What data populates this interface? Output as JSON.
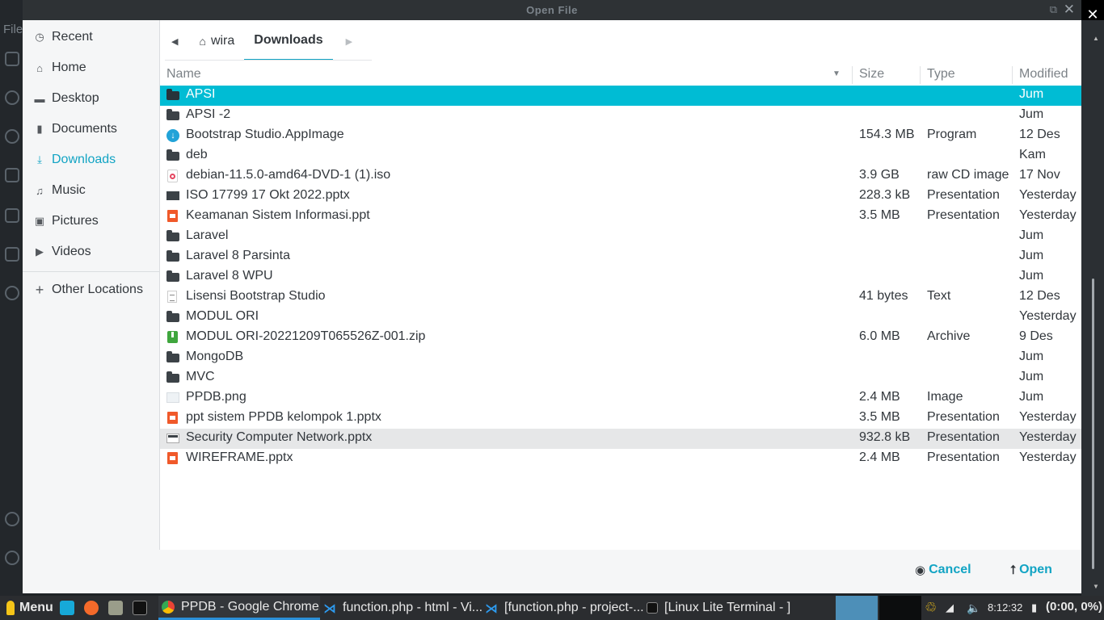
{
  "background_app": {
    "menu_partial": "File"
  },
  "dialog": {
    "title": "Open File",
    "sidebar": [
      {
        "label": "Recent",
        "icon": "clock-icon"
      },
      {
        "label": "Home",
        "icon": "home-icon"
      },
      {
        "label": "Desktop",
        "icon": "desktop-icon"
      },
      {
        "label": "Documents",
        "icon": "document-icon"
      },
      {
        "label": "Downloads",
        "icon": "download-icon",
        "active": true
      },
      {
        "label": "Music",
        "icon": "music-icon"
      },
      {
        "label": "Pictures",
        "icon": "picture-icon"
      },
      {
        "label": "Videos",
        "icon": "video-icon"
      },
      {
        "label": "Other Locations",
        "icon": "plus-icon"
      }
    ],
    "path": {
      "home": "wira",
      "current": "Downloads"
    },
    "columns": {
      "name": "Name",
      "size": "Size",
      "type": "Type",
      "modified": "Modified"
    },
    "files": [
      {
        "name": "APSI",
        "size": "",
        "type": "",
        "modified": "Jum",
        "icon": "folder-icon",
        "selected": true
      },
      {
        "name": "APSI -2",
        "size": "",
        "type": "",
        "modified": "Jum",
        "icon": "folder-icon"
      },
      {
        "name": "Bootstrap Studio.AppImage",
        "size": "154.3 MB",
        "type": "Program",
        "modified": "12 Des",
        "icon": "appimage-icon"
      },
      {
        "name": "deb",
        "size": "",
        "type": "",
        "modified": "Kam",
        "icon": "folder-icon"
      },
      {
        "name": "debian-11.5.0-amd64-DVD-1 (1).iso",
        "size": "3.9 GB",
        "type": "raw CD image",
        "modified": "17 Nov",
        "icon": "disc-image-icon"
      },
      {
        "name": "ISO 17799 17 Okt 2022.pptx",
        "size": "228.3 kB",
        "type": "Presentation",
        "modified": "Yesterday",
        "icon": "presentation-thumb-icon"
      },
      {
        "name": "Keamanan Sistem Informasi.ppt",
        "size": "3.5 MB",
        "type": "Presentation",
        "modified": "Yesterday",
        "icon": "presentation-icon"
      },
      {
        "name": "Laravel",
        "size": "",
        "type": "",
        "modified": "Jum",
        "icon": "folder-icon"
      },
      {
        "name": "Laravel 8 Parsinta",
        "size": "",
        "type": "",
        "modified": "Jum",
        "icon": "folder-icon"
      },
      {
        "name": "Laravel 8 WPU",
        "size": "",
        "type": "",
        "modified": "Jum",
        "icon": "folder-icon"
      },
      {
        "name": "Lisensi Bootstrap Studio",
        "size": "41 bytes",
        "type": "Text",
        "modified": "12 Des",
        "icon": "text-file-icon"
      },
      {
        "name": "MODUL ORI",
        "size": "",
        "type": "",
        "modified": "Yesterday",
        "icon": "folder-icon"
      },
      {
        "name": "MODUL ORI-20221209T065526Z-001.zip",
        "size": "6.0 MB",
        "type": "Archive",
        "modified": "9 Des",
        "icon": "archive-icon"
      },
      {
        "name": "MongoDB",
        "size": "",
        "type": "",
        "modified": "Jum",
        "icon": "folder-icon"
      },
      {
        "name": "MVC",
        "size": "",
        "type": "",
        "modified": "Jum",
        "icon": "folder-icon"
      },
      {
        "name": "PPDB.png",
        "size": "2.4 MB",
        "type": "Image",
        "modified": "Jum",
        "icon": "image-thumb-icon"
      },
      {
        "name": "ppt sistem PPDB kelompok 1.pptx",
        "size": "3.5 MB",
        "type": "Presentation",
        "modified": "Yesterday",
        "icon": "presentation-icon"
      },
      {
        "name": "Security Computer Network.pptx",
        "size": "932.8 kB",
        "type": "Presentation",
        "modified": "Yesterday",
        "icon": "presentation-thumb-light-icon",
        "hover": true
      },
      {
        "name": "WIREFRAME.pptx",
        "size": "2.4 MB",
        "type": "Presentation",
        "modified": "Yesterday",
        "icon": "presentation-icon"
      }
    ],
    "buttons": {
      "cancel": "Cancel",
      "open": "Open"
    }
  },
  "taskbar": {
    "menu": "Menu",
    "windows": [
      {
        "label": "PPDB - Google Chrome",
        "icon": "chrome-icon",
        "active": true
      },
      {
        "label": "function.php - html - Vi...",
        "icon": "vscode-icon"
      },
      {
        "label": "[function.php - project-...",
        "icon": "vscode-icon"
      },
      {
        "label": "[Linux Lite Terminal - ]",
        "icon": "terminal-icon"
      }
    ],
    "clock": "8:12:32",
    "battery": "(0:00, 0%)"
  },
  "colors": {
    "accent": "#12a4c4",
    "selection": "#00bcd4",
    "taskbar": "#2b2d30"
  }
}
